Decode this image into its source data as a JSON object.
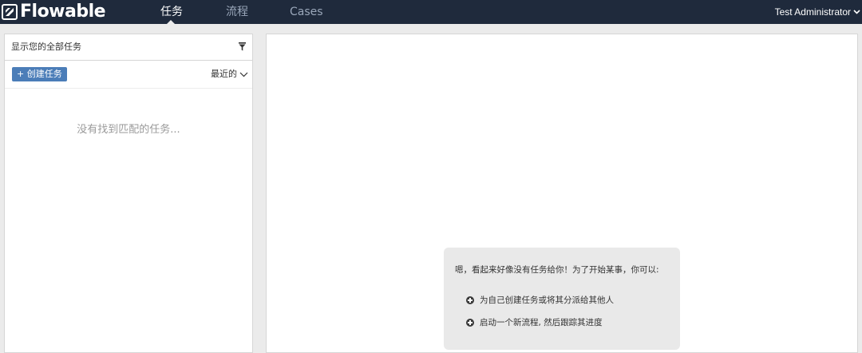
{
  "app": {
    "logo_text": "Flowable"
  },
  "nav": {
    "tabs": [
      {
        "label": "任务",
        "active": true
      },
      {
        "label": "流程",
        "active": false
      },
      {
        "label": "Cases",
        "active": false
      }
    ],
    "user": "Test Administrator"
  },
  "sidebar": {
    "filter_label": "显示您的全部任务",
    "create_button": "+ 创建任务",
    "sort_label": "最近的",
    "empty_message": "没有找到匹配的任务..."
  },
  "help": {
    "intro": "嗯，看起来好像没有任务给你！为了开始某事，你可以:",
    "items": [
      "为自己创建任务或将其分派给其他人",
      "启动一个新流程, 然后跟踪其进度"
    ]
  },
  "colors": {
    "topbar": "#1f2a3c",
    "accent": "#4b7db8",
    "background": "#ebebeb"
  }
}
